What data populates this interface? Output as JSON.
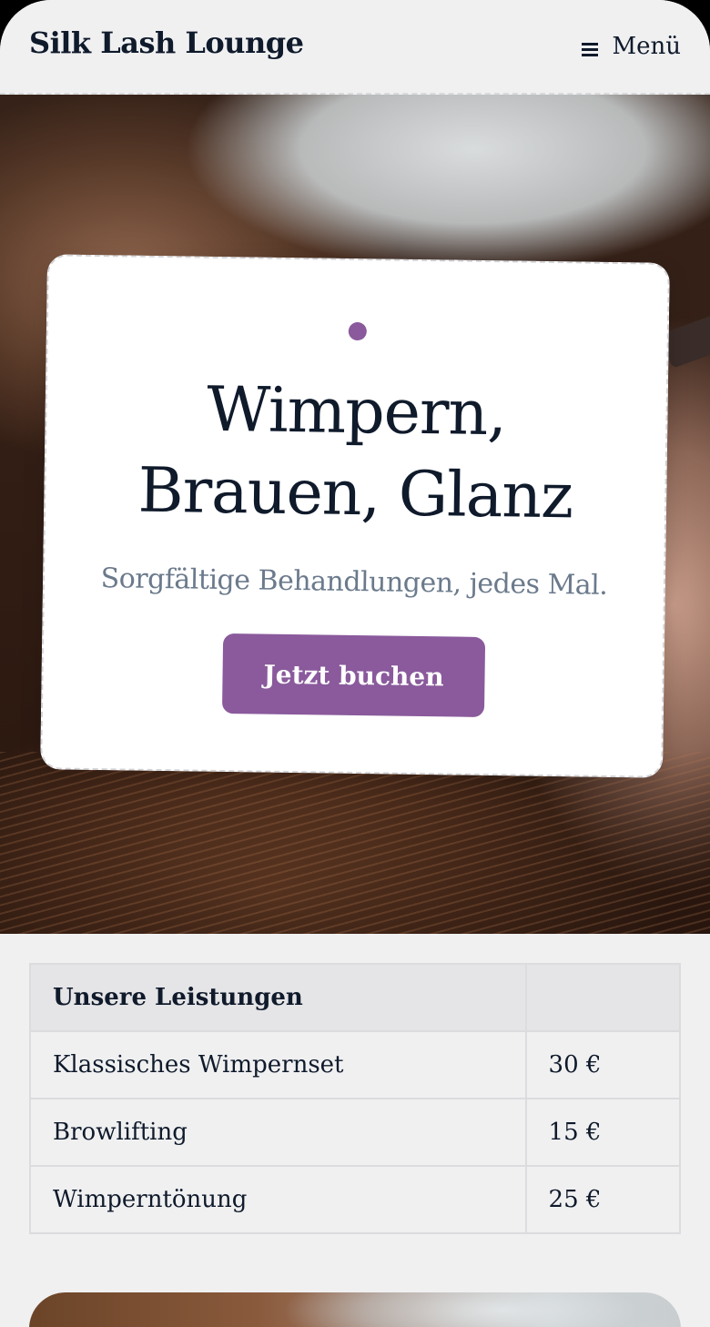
{
  "header": {
    "brand": "Silk Lash Lounge",
    "menu_icon": "hamburger-icon",
    "menu_label": "Menü"
  },
  "hero": {
    "image_alt": "lash treatment close-up",
    "accent_color": "#8a5a9c",
    "title": "Wimpern, Brauen, Glanz",
    "subtitle": "Sorgfältige Behandlungen, jedes Mal.",
    "cta_label": "Jetzt buchen"
  },
  "services": {
    "header": {
      "name": "Unsere Leistungen",
      "price": ""
    },
    "rows": [
      {
        "name": "Klassisches Wimpernset",
        "price": "30 €"
      },
      {
        "name": "Browlifting",
        "price": "15 €"
      },
      {
        "name": "Wimperntönung",
        "price": "25 €"
      }
    ]
  },
  "colors": {
    "background": "#f0f0f1",
    "text": "#0f1a2b",
    "muted": "#6b7a8c",
    "accent": "#8a5a9c"
  }
}
